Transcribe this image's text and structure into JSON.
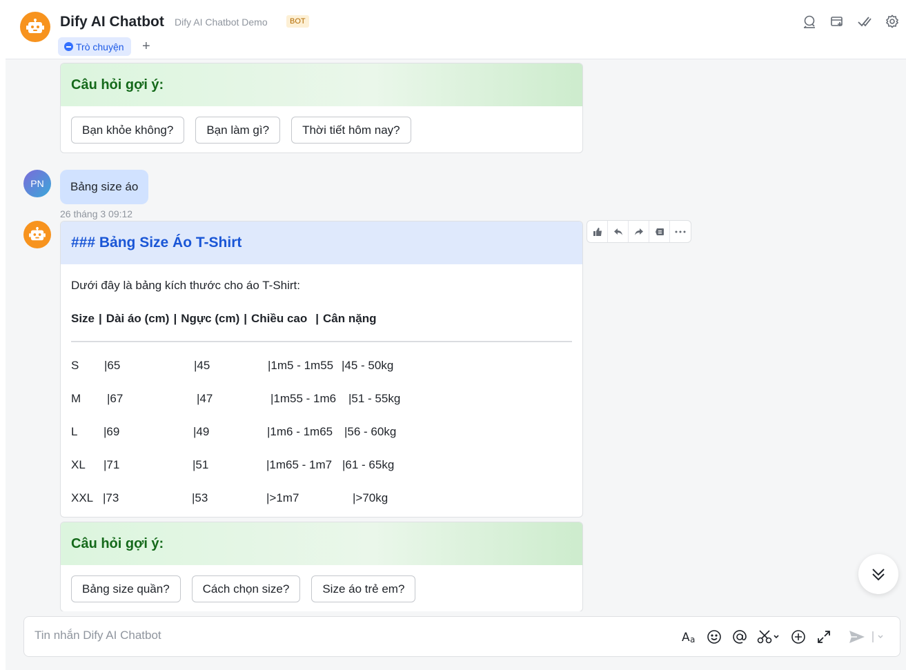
{
  "header": {
    "title": "Dify AI Chatbot",
    "subtitle": "Dify AI Chatbot Demo",
    "badge": "BOT",
    "tab_label": "Trò chuyện",
    "add_tab": "+"
  },
  "suggest_top": {
    "heading": "Câu hỏi gợi ý:",
    "buttons": [
      "Bạn khỏe không?",
      "Bạn làm gì?",
      "Thời tiết hôm nay?"
    ]
  },
  "user_message": {
    "initials": "PN",
    "text": "Bảng size áo",
    "timestamp": "26 tháng 3 09:12"
  },
  "answer": {
    "heading": "### Bảng Size Áo T-Shirt",
    "intro": "Dưới đây là bảng kích thước cho áo T-Shirt:",
    "header_cells": [
      "Size",
      "|",
      "Dài áo (cm)",
      "|",
      "Ngực (cm)",
      "|",
      "Chiều cao",
      "|",
      "Cân nặng"
    ],
    "rows": [
      [
        "S",
        "|65",
        "|45",
        "|1m5 - 1m55",
        "|45 - 50kg"
      ],
      [
        "M",
        "|67",
        "|47",
        "|1m55 - 1m6",
        "|51 - 55kg"
      ],
      [
        "L",
        "|69",
        "|49",
        "|1m6 - 1m65",
        "|56 - 60kg"
      ],
      [
        "XL",
        "|71",
        "|51",
        "|1m65 - 1m7",
        "|61 - 65kg"
      ],
      [
        "XXL",
        "|73",
        "|53",
        "|>1m7",
        "|>70kg"
      ]
    ]
  },
  "suggest_bottom": {
    "heading": "Câu hỏi gợi ý:",
    "buttons": [
      "Bảng size quần?",
      "Cách chọn size?",
      "Size áo trẻ em?"
    ]
  },
  "actions": [
    "thumbs-up-icon",
    "reply-icon",
    "forward-icon",
    "quote-icon",
    "more-icon"
  ],
  "input": {
    "placeholder": "Tin nhắn Dify AI Chatbot"
  },
  "colors": {
    "accent": "#3370ff",
    "bot_avatar": "#f7931e",
    "suggest_heading": "#14691a",
    "answer_heading": "#1a56d6"
  }
}
